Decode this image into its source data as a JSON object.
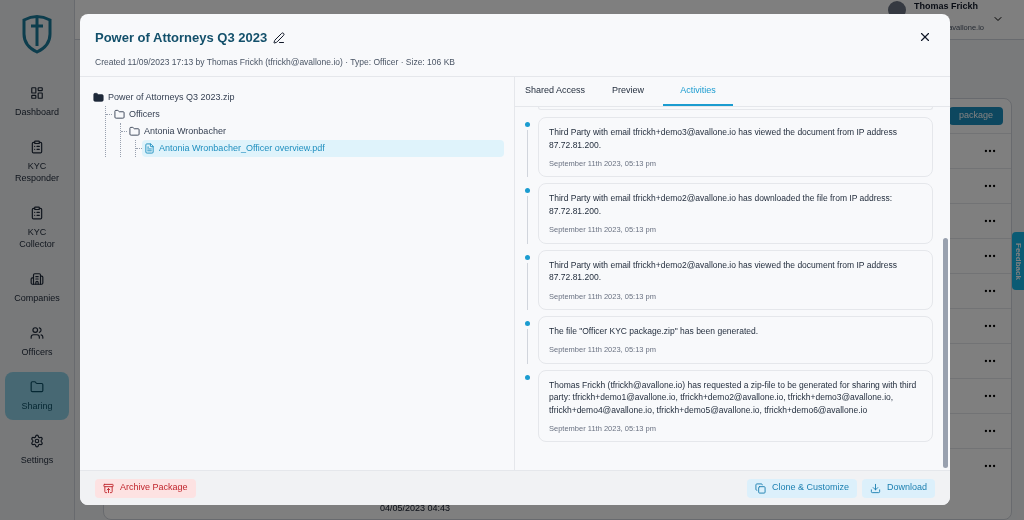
{
  "sidebar": {
    "items": [
      {
        "label": "Dashboard",
        "selected": false
      },
      {
        "label": "KYC Responder",
        "selected": false
      },
      {
        "label": "KYC Collector",
        "selected": false
      },
      {
        "label": "Companies",
        "selected": false
      },
      {
        "label": "Officers",
        "selected": false
      },
      {
        "label": "Sharing",
        "selected": true
      },
      {
        "label": "Settings",
        "selected": false
      }
    ]
  },
  "header": {
    "user_name": "Thomas Frickh",
    "user_email": "avallone.io"
  },
  "background": {
    "button": "package",
    "row_date": "04/05/2023 04:43",
    "feedback": "Feedback"
  },
  "modal": {
    "title": "Power of Attorneys Q3 2023",
    "meta": "Created 11/09/2023 17:13 by Thomas Frickh (tfrickh@avallone.io) · Type: Officer · Size: 106 KB",
    "tree": [
      {
        "label": "Power of Attorneys Q3 2023.zip",
        "kind": "zip",
        "selected": false,
        "children": [
          {
            "label": "Officers",
            "kind": "folder",
            "selected": false,
            "children": [
              {
                "label": "Antonia Wronbacher",
                "kind": "folder",
                "selected": false,
                "children": [
                  {
                    "label": "Antonia Wronbacher_Officer overview.pdf",
                    "kind": "file",
                    "selected": true
                  }
                ]
              }
            ]
          }
        ]
      }
    ],
    "tabs": [
      {
        "label": "Shared Access",
        "selected": false
      },
      {
        "label": "Preview",
        "selected": false
      },
      {
        "label": "Activities",
        "selected": true
      }
    ],
    "activities": [
      {
        "text": "Third Party with email tfrickh+demo3@avallone.io has viewed the document from IP address 87.72.81.200.",
        "time": "September 11th 2023, 05:13 pm"
      },
      {
        "text": "Third Party with email tfrickh+demo2@avallone.io has downloaded the file from IP address: 87.72.81.200.",
        "time": "September 11th 2023, 05:13 pm"
      },
      {
        "text": "Third Party with email tfrickh+demo2@avallone.io has viewed the document from IP address 87.72.81.200.",
        "time": "September 11th 2023, 05:13 pm"
      },
      {
        "text": "The file \"Officer KYC package.zip\" has been generated.",
        "time": "September 11th 2023, 05:13 pm"
      },
      {
        "text": "Thomas Frickh (tfrickh@avallone.io) has requested a zip-file to be generated for sharing with third party: tfrickh+demo1@avallone.io, tfrickh+demo2@avallone.io, tfrickh+demo3@avallone.io, tfrickh+demo4@avallone.io, tfrickh+demo5@avallone.io, tfrickh+demo6@avallone.io",
        "time": "September 11th 2023, 05:13 pm"
      }
    ],
    "archive_button": "Archive Package",
    "clone_button": "Clone & Customize",
    "download_button": "Download"
  }
}
